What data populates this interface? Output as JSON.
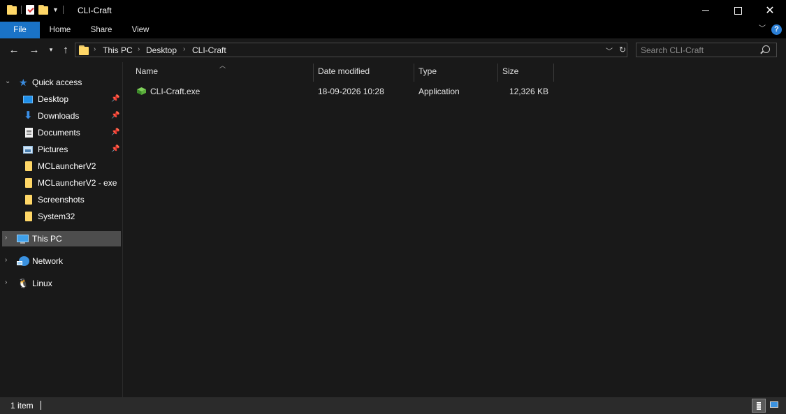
{
  "window": {
    "title": "CLI-Craft"
  },
  "ribbon": {
    "tabs": [
      "File",
      "Home",
      "Share",
      "View"
    ],
    "help_label": "?"
  },
  "address": {
    "crumbs": [
      "This PC",
      "Desktop",
      "CLI-Craft"
    ]
  },
  "search": {
    "placeholder": "Search CLI-Craft"
  },
  "sidebar": {
    "quick_access": "Quick access",
    "pinned": [
      "Desktop",
      "Downloads",
      "Documents",
      "Pictures"
    ],
    "folders": [
      "MCLauncherV2",
      "MCLauncherV2 - exe",
      "Screenshots",
      "System32"
    ],
    "this_pc": "This PC",
    "network": "Network",
    "linux": "Linux"
  },
  "columns": [
    "Name",
    "Date modified",
    "Type",
    "Size"
  ],
  "files": [
    {
      "name": "CLI-Craft.exe",
      "date": "18-09-2026 10:28",
      "type": "Application",
      "size": "12,326 KB"
    }
  ],
  "status": {
    "count": "1 item"
  },
  "colors": {
    "accent": "#1a73c7",
    "selected": "#4d4d4d",
    "folder": "#ffd767"
  }
}
